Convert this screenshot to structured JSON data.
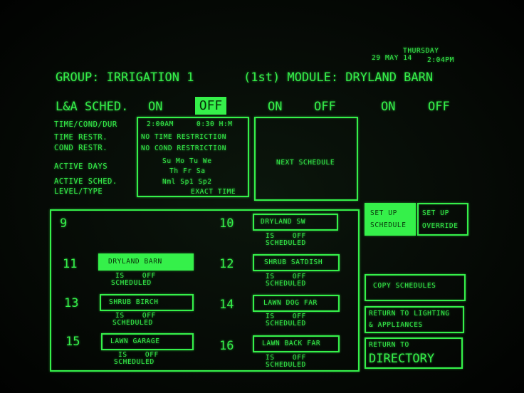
{
  "datetime": {
    "day": "THURSDAY",
    "date": "29 MAY 14",
    "time": "2:04PM"
  },
  "header": {
    "group_line": "GROUP: IRRIGATION 1",
    "module_line": "(1st) MODULE: DRYLAND BARN"
  },
  "sched_row": {
    "label": "L&A SCHED.",
    "toggles": [
      "ON",
      "OFF",
      "ON",
      "OFF",
      "ON",
      "OFF"
    ]
  },
  "labels": {
    "time_cond_dur": "TIME/COND/DUR",
    "time_restr": "TIME RESTR.",
    "cond_restr": "COND RESTR.",
    "active_days": "ACTIVE DAYS",
    "active_sched": "ACTIVE SCHED.",
    "level_type": "LEVEL/TYPE"
  },
  "schedule_box": {
    "start_time": "2:00AM",
    "duration": "0:30 H:M",
    "time_restriction": "NO TIME RESTRICTION",
    "cond_restriction": "NO COND RESTRICTION",
    "days_line1": "Su Mo Tu We",
    "days_line2": "Th Fr Sa",
    "active_sched": "Nml Sp1 Sp2",
    "level_type": "EXACT TIME"
  },
  "next_schedule": "NEXT SCHEDULE",
  "modules": [
    {
      "num": "9",
      "name": "",
      "status": ""
    },
    {
      "num": "10",
      "name": "DRYLAND SW",
      "status_is": "IS    OFF",
      "status_sched": "SCHEDULED"
    },
    {
      "num": "11",
      "name": "DRYLAND BARN",
      "status_is": "IS    OFF",
      "status_sched": "SCHEDULED"
    },
    {
      "num": "12",
      "name": "SHRUB SATDISH",
      "status_is": "IS    OFF",
      "status_sched": "SCHEDULED"
    },
    {
      "num": "13",
      "name": "SHRUB BIRCH",
      "status_is": "IS    OFF",
      "status_sched": "SCHEDULED"
    },
    {
      "num": "14",
      "name": "LAWN DOG FAR",
      "status_is": "IS    OFF",
      "status_sched": "SCHEDULED"
    },
    {
      "num": "15",
      "name": "LAWN GARAGE",
      "status_is": "IS    OFF",
      "status_sched": "SCHEDULED"
    },
    {
      "num": "16",
      "name": "LAWN BACK FAR",
      "status_is": "IS    OFF",
      "status_sched": "SCHEDULED"
    }
  ],
  "buttons": {
    "setup_schedule_1": "SET UP",
    "setup_schedule_2": "SCHEDULE",
    "setup_override_1": "SET UP",
    "setup_override_2": "OVERRIDE",
    "copy_schedules": "COPY SCHEDULES",
    "return_lighting_1": "RETURN TO LIGHTING",
    "return_lighting_2": "& APPLIANCES",
    "return_directory_1": "RETURN TO",
    "return_directory_2": "DIRECTORY"
  },
  "colors": {
    "phosphor": "#35f04a",
    "background": "#050805"
  }
}
